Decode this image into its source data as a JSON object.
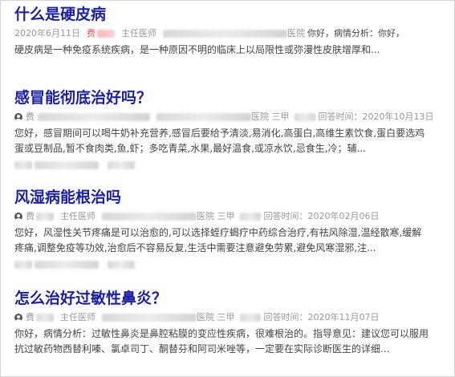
{
  "results": [
    {
      "title": "什么是硬皮病",
      "date": "2020年6月11日",
      "doctor": "费",
      "role": "主任医师",
      "hospital_suffix": "医院",
      "prefix": "你好，病情分析：你好，",
      "snippet": "硬皮病是一种免疫系统疾病，是一种原因不明的临床上以局限性或弥漫性皮肤增厚和..."
    },
    {
      "title": "感冒能彻底治好吗？",
      "doctor": "费",
      "hospital_suffix": "医院 三甲",
      "answer_time": "回答时间：2020年10月13日",
      "snippet_lines": [
        "您好，感冒期间可以喝牛奶补充营养,感冒后要给予清淡,易消化,高蛋白,高维生素饮食,蛋白要选鸡",
        "蛋或豆制品,暂不食肉类,鱼,虾；多吃青菜,水果,最好温食,或凉水饮,忌食生,冷；辅..."
      ]
    },
    {
      "title": "风湿病能根治吗",
      "doctor": "费",
      "role": "主任医师",
      "hospital_suffix": "医院 三甲",
      "answer_time": "回答时间：2020年02月06日",
      "snippet_lines": [
        "您好，风湿性关节疼痛是可以治愈的,可以选择蛭疗蝎疗中药综合治疗,有祛风除湿,温经散寒,缓解",
        "疼痛,调整免疫等功效,治愈后不容易反复,生活中需要注意避免劳累,避免风寒湿邪,注..."
      ]
    },
    {
      "title": "怎么治好过敏性鼻炎？",
      "doctor": "费",
      "role": "主任医师",
      "hospital_suffix": "医院 三甲",
      "answer_time": "回答时间：2020年11月07日",
      "snippet_lines": [
        "你好，病情分析：过敏性鼻炎是鼻腔粘膜的变应性疾病，很难根治的。指导意见：建议您可以服用",
        "抗过敏药物西替利嗪、氯卓司丁、酮替芬和阿司米唑等，一定要在实际诊断医生的详细..."
      ]
    }
  ]
}
